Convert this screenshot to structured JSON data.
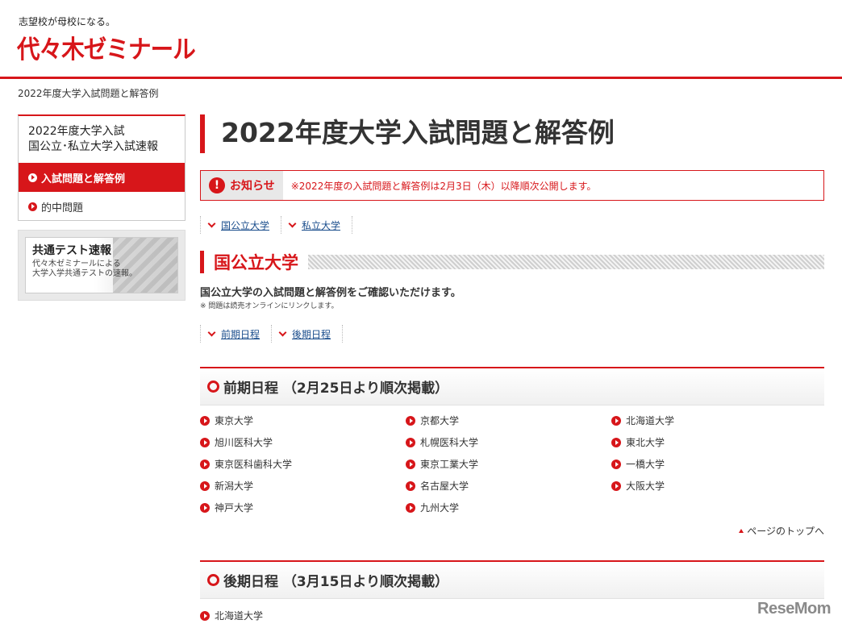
{
  "header": {
    "tagline": "志望校が母校になる。",
    "logo": "代々木ゼミナール"
  },
  "breadcrumb": "2022年度大学入試問題と解答例",
  "sidebar": {
    "title_line1": "2022年度大学入試",
    "title_line2": "国公立･私立大学入試速報",
    "items": [
      {
        "label": "入試問題と解答例",
        "active": true
      },
      {
        "label": "的中問題",
        "active": false
      }
    ],
    "banner": {
      "title": "共通テスト速報",
      "text_line1": "代々木ゼミナールによる",
      "text_line2": "大学入学共通テストの速報。"
    }
  },
  "main": {
    "title": "2022年度大学入試問題と解答例",
    "notice": {
      "label": "お知らせ",
      "text": "※2022年度の入試問題と解答例は2月3日（木）以降順次公開します。"
    },
    "top_anchors": [
      "国公立大学",
      "私立大学"
    ],
    "section": {
      "title": "国公立大学",
      "description": "国公立大学の入試問題と解答例をご確認いただけます。",
      "note": "※ 問題は読売オンラインにリンクします。",
      "anchors": [
        "前期日程",
        "後期日程"
      ]
    },
    "zenki": {
      "title": "前期日程 （2月25日より順次掲載）",
      "universities": [
        [
          "東京大学",
          "京都大学",
          "北海道大学"
        ],
        [
          "旭川医科大学",
          "札幌医科大学",
          "東北大学"
        ],
        [
          "東京医科歯科大学",
          "東京工業大学",
          "一橋大学"
        ],
        [
          "新潟大学",
          "名古屋大学",
          "大阪大学"
        ],
        [
          "神戸大学",
          "九州大学"
        ]
      ]
    },
    "page_top": "ページのトップへ",
    "koki": {
      "title": "後期日程 （3月15日より順次掲載）",
      "universities": [
        "北海道大学"
      ]
    }
  },
  "watermark": "ReseMom"
}
